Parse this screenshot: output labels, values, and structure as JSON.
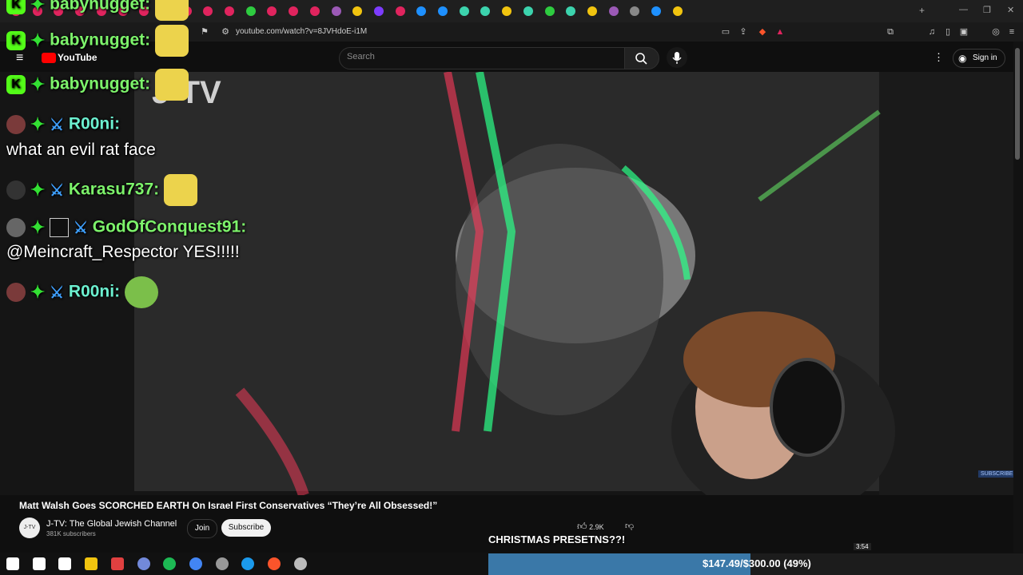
{
  "browser": {
    "url": "youtube.com/watch?v=8JVHdoE-i1M",
    "tab_colors": [
      "#e0245e",
      "#e0245e",
      "#e0245e",
      "#e0245e",
      "#e0245e",
      "#e0245e",
      "#e0245e",
      "#e0245e",
      "#e0245e",
      "#e0245e",
      "#e0245e",
      "#2ecc40",
      "#e0245e",
      "#e0245e",
      "#e0245e",
      "#9b59b6",
      "#f1c40f",
      "#7d3cff",
      "#e0245e",
      "#1e90ff",
      "#1e90ff",
      "#3cd3ad",
      "#3cd3ad",
      "#f1c40f",
      "#3cd3ad",
      "#2ecc40",
      "#3cd3ad",
      "#f1c40f",
      "#9b59b6",
      "#888888",
      "#1e90ff",
      "#f1c40f"
    ]
  },
  "youtube": {
    "logo_text": "YouTube",
    "search_placeholder": "Search",
    "sign_in_label": "Sign in",
    "video_title": "Matt Walsh Goes SCORCHED EARTH On Israel First Conservatives “They’re All Obsessed!”",
    "channel_name": "J-TV: The Global Jewish Channel",
    "channel_subs": "381K subscribers",
    "channel_avatar_text": "J-TV",
    "join_label": "Join",
    "subscribe_label": "Subscribe",
    "likes": "2.9K",
    "watermark": "J-TV",
    "subscribe_tag": "SUBSCRIBE",
    "duration": "3:54"
  },
  "chat": {
    "messages": [
      {
        "user": "babynugget:",
        "text": "",
        "emote": "smiling-bee-emote"
      },
      {
        "user": "babynugget:",
        "text": "",
        "emote": "smiling-bee-emote"
      },
      {
        "user": "R00ni:",
        "text": "",
        "emote": ""
      },
      {
        "user": "",
        "text": "what an evil rat face",
        "emote": ""
      },
      {
        "user": "Karasu737:",
        "text": "",
        "emote": "smiling-bee-emote"
      },
      {
        "user": "GodOfConquest91:",
        "text": "",
        "emote": ""
      },
      {
        "user": "",
        "text": "@Meincraft_Respector YES!!!!!",
        "emote": ""
      },
      {
        "user": "R00ni:",
        "text": "",
        "emote": "pepe-shout-emote"
      }
    ]
  },
  "stream": {
    "overlay_text": "CHRISTMAS PRESETNS??!",
    "goal_text": "$147.49/$300.00 (49%)",
    "goal_fraction": 0.49,
    "goal_color": "#3a78a8"
  },
  "taskbar": {
    "icons": [
      "windows-start-icon",
      "search-icon",
      "task-view-icon",
      "file-explorer-icon",
      "obs-icon",
      "discord-icon",
      "spotify-icon",
      "chrome-icon",
      "app-icon",
      "steam-icon",
      "brave-icon",
      "app-icon"
    ]
  }
}
